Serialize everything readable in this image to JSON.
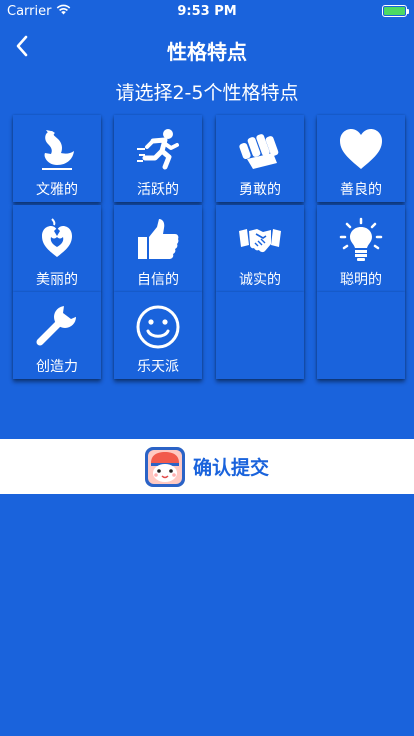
{
  "status_bar": {
    "carrier": "Carrier",
    "time": "9:53 PM",
    "battery_color": "#4cd964"
  },
  "nav": {
    "title": "性格特点",
    "back_icon": "chevron-left-icon"
  },
  "subtitle": "请选择2-5个性格特点",
  "traits": [
    {
      "label": "文雅的",
      "icon": "swan-icon"
    },
    {
      "label": "活跃的",
      "icon": "runner-icon"
    },
    {
      "label": "勇敢的",
      "icon": "fist-icon"
    },
    {
      "label": "善良的",
      "icon": "heart-icon"
    },
    {
      "label": "美丽的",
      "icon": "heart-flower-icon"
    },
    {
      "label": "自信的",
      "icon": "thumbs-up-icon"
    },
    {
      "label": "诚实的",
      "icon": "handshake-icon"
    },
    {
      "label": "聪明的",
      "icon": "lightbulb-icon"
    },
    {
      "label": "创造力",
      "icon": "wrench-icon"
    },
    {
      "label": "乐天派",
      "icon": "smiley-icon"
    }
  ],
  "confirm": {
    "label": "确认提交",
    "avatar_icon": "cartoon-avatar-icon"
  },
  "colors": {
    "background": "#1a63dc",
    "card_text": "#ffffff",
    "confirm_text": "#1a63dc"
  }
}
